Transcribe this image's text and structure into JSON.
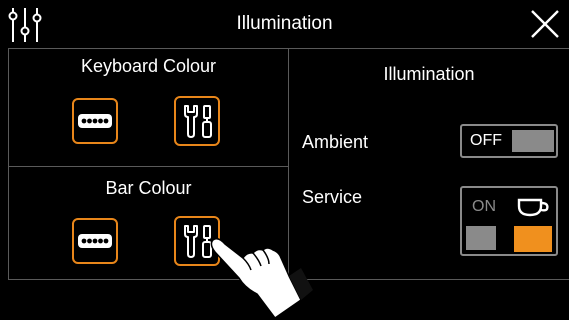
{
  "header": {
    "title": "Illumination",
    "left_icon": "settings-sliders-icon",
    "right_icon": "close-icon"
  },
  "left_panel": {
    "keyboard_colour": {
      "title": "Keyboard Colour",
      "buttons": [
        {
          "icon": "dots-icon"
        },
        {
          "icon": "wrench-screwdriver-icon"
        }
      ]
    },
    "bar_colour": {
      "title": "Bar Colour",
      "buttons": [
        {
          "icon": "dots-icon"
        },
        {
          "icon": "wrench-screwdriver-icon"
        }
      ]
    }
  },
  "right_panel": {
    "title": "Illumination",
    "ambient": {
      "label": "Ambient",
      "state_text": "OFF",
      "icon": "toggle-switch-icon"
    },
    "service": {
      "label": "Service",
      "state_text": "ON",
      "icon": "coffee-cup-icon",
      "swatches": [
        "#8a8a8a",
        "#f0901e"
      ]
    }
  },
  "colors": {
    "accent": "#e8861a",
    "background": "#000000",
    "border": "#5a5a5a",
    "grey": "#8a8a8a"
  }
}
